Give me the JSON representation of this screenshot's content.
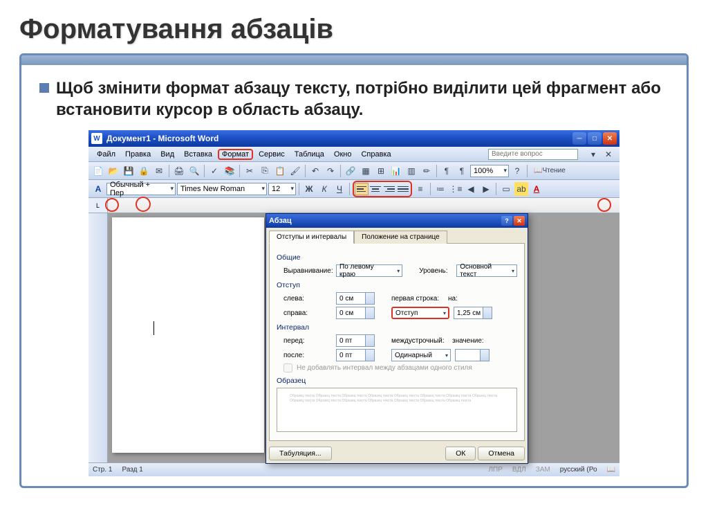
{
  "slide": {
    "title": "Форматування абзаців",
    "bullet": "Щоб змінити формат абзацу тексту, потрібно виділити цей фрагмент або встановити курсор в область абзацу."
  },
  "word": {
    "title": "Документ1 - Microsoft Word",
    "menu": {
      "file": "Файл",
      "edit": "Правка",
      "view": "Вид",
      "insert": "Вставка",
      "format": "Формат",
      "service": "Сервис",
      "table": "Таблица",
      "window": "Окно",
      "help": "Справка"
    },
    "help_placeholder": "Введите вопрос",
    "style_combo": "Обычный + Пер",
    "font_combo": "Times New Roman",
    "size_combo": "12",
    "zoom": "100%",
    "read_btn": "Чтение",
    "bold": "Ж",
    "italic": "К",
    "underline": "Ч",
    "status": {
      "page": "Стр. 1",
      "section": "Разд 1",
      "lpr": "ЛПР",
      "vdl": "ВДЛ",
      "zam": "ЗАМ",
      "lang": "русский (Ро"
    }
  },
  "dialog": {
    "title": "Абзац",
    "tab1": "Отступы и интервалы",
    "tab2": "Положение на странице",
    "sect_general": "Общие",
    "align_label": "Выравнивание:",
    "align_value": "По левому краю",
    "level_label": "Уровень:",
    "level_value": "Основной текст",
    "sect_indent": "Отступ",
    "left_label": "слева:",
    "left_value": "0 см",
    "right_label": "справа:",
    "right_value": "0 см",
    "first_label": "первая строка:",
    "first_value": "Отступ",
    "on_label": "на:",
    "on_value": "1,25 см",
    "sect_interval": "Интервал",
    "before_label": "перед:",
    "before_value": "0 пт",
    "after_label": "после:",
    "after_value": "0 пт",
    "line_label": "междустрочный:",
    "line_value": "Одинарный",
    "value_label": "значение:",
    "nospc": "Не добавлять интервал между абзацами одного стиля",
    "sect_preview": "Образец",
    "preview_text": "Образец текста Образец текста Образец текста Образец текста Образец текста Образец текста Образец текста Образец текста Образец текста Образец текста Образец текста Образец текста Образец текста Образец текста Образец текста",
    "tabs_btn": "Табуляция...",
    "ok": "ОК",
    "cancel": "Отмена"
  }
}
